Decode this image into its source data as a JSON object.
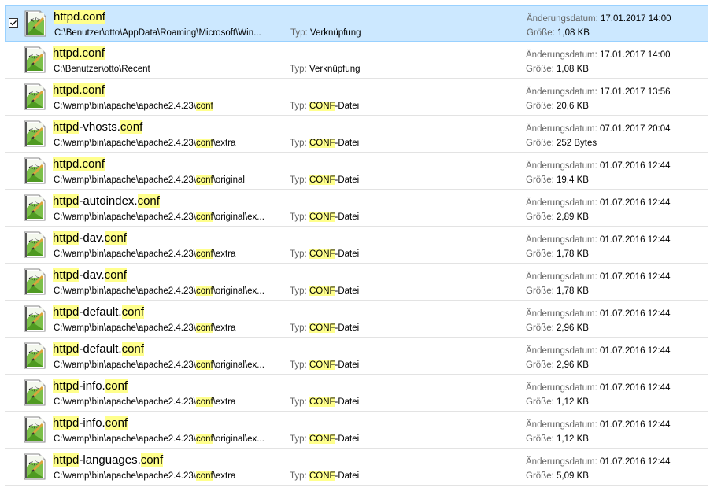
{
  "labels": {
    "type": "Typ:",
    "date": "Änderungsdatum:",
    "size": "Größe:"
  },
  "highlight_color": "#ffff8c",
  "selection_color": "#cce8ff",
  "rows": [
    {
      "name_parts": [
        {
          "t": "httpd.conf",
          "hl": true
        }
      ],
      "path_parts": [
        {
          "t": "C:\\Benutzer\\otto\\AppData\\Roaming\\Microsoft\\Win...",
          "hl": false
        }
      ],
      "type_parts": [
        {
          "t": "Verknüpfung",
          "hl": false
        }
      ],
      "date": "17.01.2017 14:00",
      "size": "1,08 KB",
      "selected": true,
      "icon": "notepad-plus-plus-file-icon"
    },
    {
      "name_parts": [
        {
          "t": "httpd.conf",
          "hl": true
        }
      ],
      "path_parts": [
        {
          "t": "C:\\Benutzer\\otto\\Recent",
          "hl": false
        }
      ],
      "type_parts": [
        {
          "t": "Verknüpfung",
          "hl": false
        }
      ],
      "date": "17.01.2017 14:00",
      "size": "1,08 KB",
      "selected": false,
      "icon": "notepad-plus-plus-file-icon"
    },
    {
      "name_parts": [
        {
          "t": "httpd.conf",
          "hl": true
        }
      ],
      "path_parts": [
        {
          "t": "C:\\wamp\\bin\\apache\\apache2.4.23\\",
          "hl": false
        },
        {
          "t": "conf",
          "hl": true
        }
      ],
      "type_parts": [
        {
          "t": "CONF",
          "hl": true
        },
        {
          "t": "-Datei",
          "hl": false
        }
      ],
      "date": "17.01.2017 13:56",
      "size": "20,6 KB",
      "selected": false,
      "icon": "notepad-plus-plus-file-icon"
    },
    {
      "name_parts": [
        {
          "t": "httpd",
          "hl": true
        },
        {
          "t": "-vhosts.",
          "hl": false
        },
        {
          "t": "conf",
          "hl": true
        }
      ],
      "path_parts": [
        {
          "t": "C:\\wamp\\bin\\apache\\apache2.4.23\\",
          "hl": false
        },
        {
          "t": "conf",
          "hl": true
        },
        {
          "t": "\\extra",
          "hl": false
        }
      ],
      "type_parts": [
        {
          "t": "CONF",
          "hl": true
        },
        {
          "t": "-Datei",
          "hl": false
        }
      ],
      "date": "07.01.2017 20:04",
      "size": "252 Bytes",
      "selected": false,
      "icon": "notepad-plus-plus-file-icon"
    },
    {
      "name_parts": [
        {
          "t": "httpd.conf",
          "hl": true
        }
      ],
      "path_parts": [
        {
          "t": "C:\\wamp\\bin\\apache\\apache2.4.23\\",
          "hl": false
        },
        {
          "t": "conf",
          "hl": true
        },
        {
          "t": "\\original",
          "hl": false
        }
      ],
      "type_parts": [
        {
          "t": "CONF",
          "hl": true
        },
        {
          "t": "-Datei",
          "hl": false
        }
      ],
      "date": "01.07.2016 12:44",
      "size": "19,4 KB",
      "selected": false,
      "icon": "notepad-plus-plus-file-icon"
    },
    {
      "name_parts": [
        {
          "t": "httpd",
          "hl": true
        },
        {
          "t": "-autoindex.",
          "hl": false
        },
        {
          "t": "conf",
          "hl": true
        }
      ],
      "path_parts": [
        {
          "t": "C:\\wamp\\bin\\apache\\apache2.4.23\\",
          "hl": false
        },
        {
          "t": "conf",
          "hl": true
        },
        {
          "t": "\\original\\ex...",
          "hl": false
        }
      ],
      "type_parts": [
        {
          "t": "CONF",
          "hl": true
        },
        {
          "t": "-Datei",
          "hl": false
        }
      ],
      "date": "01.07.2016 12:44",
      "size": "2,89 KB",
      "selected": false,
      "icon": "notepad-plus-plus-file-icon"
    },
    {
      "name_parts": [
        {
          "t": "httpd",
          "hl": true
        },
        {
          "t": "-dav.",
          "hl": false
        },
        {
          "t": "conf",
          "hl": true
        }
      ],
      "path_parts": [
        {
          "t": "C:\\wamp\\bin\\apache\\apache2.4.23\\",
          "hl": false
        },
        {
          "t": "conf",
          "hl": true
        },
        {
          "t": "\\extra",
          "hl": false
        }
      ],
      "type_parts": [
        {
          "t": "CONF",
          "hl": true
        },
        {
          "t": "-Datei",
          "hl": false
        }
      ],
      "date": "01.07.2016 12:44",
      "size": "1,78 KB",
      "selected": false,
      "icon": "notepad-plus-plus-file-icon"
    },
    {
      "name_parts": [
        {
          "t": "httpd",
          "hl": true
        },
        {
          "t": "-dav.",
          "hl": false
        },
        {
          "t": "conf",
          "hl": true
        }
      ],
      "path_parts": [
        {
          "t": "C:\\wamp\\bin\\apache\\apache2.4.23\\",
          "hl": false
        },
        {
          "t": "conf",
          "hl": true
        },
        {
          "t": "\\original\\ex...",
          "hl": false
        }
      ],
      "type_parts": [
        {
          "t": "CONF",
          "hl": true
        },
        {
          "t": "-Datei",
          "hl": false
        }
      ],
      "date": "01.07.2016 12:44",
      "size": "1,78 KB",
      "selected": false,
      "icon": "notepad-plus-plus-file-icon"
    },
    {
      "name_parts": [
        {
          "t": "httpd",
          "hl": true
        },
        {
          "t": "-default.",
          "hl": false
        },
        {
          "t": "conf",
          "hl": true
        }
      ],
      "path_parts": [
        {
          "t": "C:\\wamp\\bin\\apache\\apache2.4.23\\",
          "hl": false
        },
        {
          "t": "conf",
          "hl": true
        },
        {
          "t": "\\extra",
          "hl": false
        }
      ],
      "type_parts": [
        {
          "t": "CONF",
          "hl": true
        },
        {
          "t": "-Datei",
          "hl": false
        }
      ],
      "date": "01.07.2016 12:44",
      "size": "2,96 KB",
      "selected": false,
      "icon": "notepad-plus-plus-file-icon"
    },
    {
      "name_parts": [
        {
          "t": "httpd",
          "hl": true
        },
        {
          "t": "-default.",
          "hl": false
        },
        {
          "t": "conf",
          "hl": true
        }
      ],
      "path_parts": [
        {
          "t": "C:\\wamp\\bin\\apache\\apache2.4.23\\",
          "hl": false
        },
        {
          "t": "conf",
          "hl": true
        },
        {
          "t": "\\original\\ex...",
          "hl": false
        }
      ],
      "type_parts": [
        {
          "t": "CONF",
          "hl": true
        },
        {
          "t": "-Datei",
          "hl": false
        }
      ],
      "date": "01.07.2016 12:44",
      "size": "2,96 KB",
      "selected": false,
      "icon": "notepad-plus-plus-file-icon"
    },
    {
      "name_parts": [
        {
          "t": "httpd",
          "hl": true
        },
        {
          "t": "-info.",
          "hl": false
        },
        {
          "t": "conf",
          "hl": true
        }
      ],
      "path_parts": [
        {
          "t": "C:\\wamp\\bin\\apache\\apache2.4.23\\",
          "hl": false
        },
        {
          "t": "conf",
          "hl": true
        },
        {
          "t": "\\extra",
          "hl": false
        }
      ],
      "type_parts": [
        {
          "t": "CONF",
          "hl": true
        },
        {
          "t": "-Datei",
          "hl": false
        }
      ],
      "date": "01.07.2016 12:44",
      "size": "1,12 KB",
      "selected": false,
      "icon": "notepad-plus-plus-file-icon"
    },
    {
      "name_parts": [
        {
          "t": "httpd",
          "hl": true
        },
        {
          "t": "-info.",
          "hl": false
        },
        {
          "t": "conf",
          "hl": true
        }
      ],
      "path_parts": [
        {
          "t": "C:\\wamp\\bin\\apache\\apache2.4.23\\",
          "hl": false
        },
        {
          "t": "conf",
          "hl": true
        },
        {
          "t": "\\original\\ex...",
          "hl": false
        }
      ],
      "type_parts": [
        {
          "t": "CONF",
          "hl": true
        },
        {
          "t": "-Datei",
          "hl": false
        }
      ],
      "date": "01.07.2016 12:44",
      "size": "1,12 KB",
      "selected": false,
      "icon": "notepad-plus-plus-file-icon"
    },
    {
      "name_parts": [
        {
          "t": "httpd",
          "hl": true
        },
        {
          "t": "-languages.",
          "hl": false
        },
        {
          "t": "conf",
          "hl": true
        }
      ],
      "path_parts": [
        {
          "t": "C:\\wamp\\bin\\apache\\apache2.4.23\\",
          "hl": false
        },
        {
          "t": "conf",
          "hl": true
        },
        {
          "t": "\\extra",
          "hl": false
        }
      ],
      "type_parts": [
        {
          "t": "CONF",
          "hl": true
        },
        {
          "t": "-Datei",
          "hl": false
        }
      ],
      "date": "01.07.2016 12:44",
      "size": "5,09 KB",
      "selected": false,
      "icon": "notepad-plus-plus-file-icon"
    }
  ]
}
